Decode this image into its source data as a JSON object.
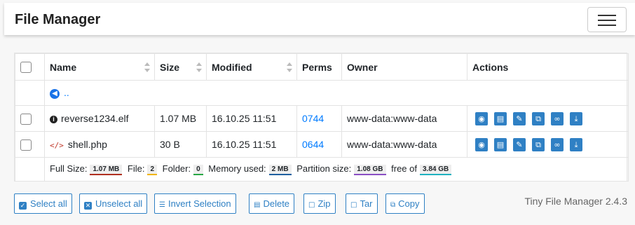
{
  "header": {
    "title": "File Manager"
  },
  "table": {
    "columns": [
      "Name",
      "Size",
      "Modified",
      "Perms",
      "Owner",
      "Actions"
    ],
    "parent_link": "..",
    "rows": [
      {
        "name": "reverse1234.elf",
        "icon": "info-circle-icon",
        "size": "1.07 MB",
        "modified": "16.10.25 11:51",
        "perms": "0744",
        "owner": "www-data:www-data"
      },
      {
        "name": "shell.php",
        "icon": "code-icon",
        "size": "30 B",
        "modified": "16.10.25 11:51",
        "perms": "0644",
        "owner": "www-data:www-data"
      }
    ],
    "actions": [
      "view-icon",
      "delete-icon",
      "rename-icon",
      "copy-icon",
      "direct-link-icon",
      "download-icon"
    ]
  },
  "footer": {
    "full_size_label": "Full Size:",
    "full_size": "1.07 MB",
    "file_label": "File:",
    "file_count": "2",
    "folder_label": "Folder:",
    "folder_count": "0",
    "memory_label": "Memory used:",
    "memory": "2 MB",
    "partition_label": "Partition size:",
    "partition": "1.08 GB",
    "free_label": "free of",
    "free": "3.84 GB"
  },
  "buttons": {
    "select_all": "Select all",
    "unselect_all": "Unselect all",
    "invert": "Invert Selection",
    "delete": "Delete",
    "zip": "Zip",
    "tar": "Tar",
    "copy": "Copy"
  },
  "version": "Tiny File Manager 2.4.3",
  "colors": {
    "accent": "#2f80c4",
    "link": "#007bff"
  }
}
